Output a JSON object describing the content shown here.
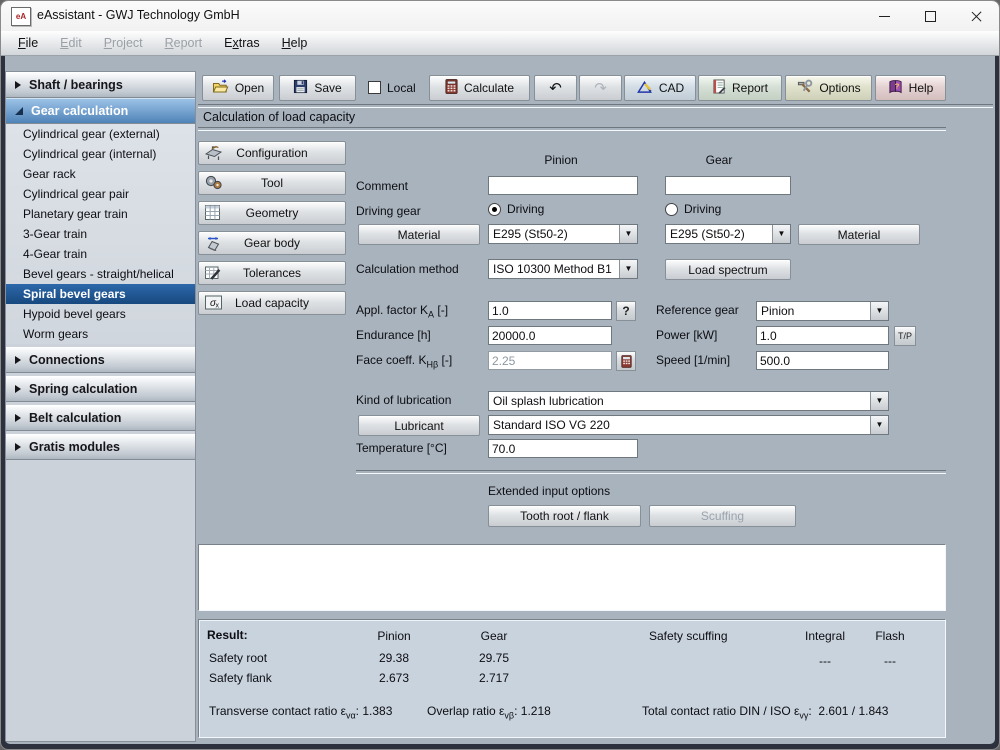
{
  "window": {
    "title": "eAssistant - GWJ Technology GmbH",
    "icon_text": "eA"
  },
  "menu": {
    "items": [
      {
        "pre": "",
        "key": "F",
        "post": "ile",
        "enabled": true
      },
      {
        "pre": "",
        "key": "E",
        "post": "dit",
        "enabled": false
      },
      {
        "pre": "",
        "key": "P",
        "post": "roject",
        "enabled": false
      },
      {
        "pre": "",
        "key": "R",
        "post": "eport",
        "enabled": false
      },
      {
        "pre": "E",
        "key": "x",
        "post": "tras",
        "enabled": true
      },
      {
        "pre": "",
        "key": "H",
        "post": "elp",
        "enabled": true
      }
    ]
  },
  "sidebar": {
    "sections": [
      {
        "label": "Shaft / bearings",
        "state": "collapsed"
      },
      {
        "label": "Gear calculation",
        "state": "expanded",
        "items": [
          "Cylindrical gear (external)",
          "Cylindrical gear (internal)",
          "Gear rack",
          "Cylindrical gear pair",
          "Planetary gear train",
          "3-Gear train",
          "4-Gear train",
          "Bevel gears - straight/helical",
          "Spiral bevel gears",
          "Hypoid bevel gears",
          "Worm gears"
        ],
        "selected_item": "Spiral bevel gears"
      },
      {
        "label": "Connections",
        "state": "collapsed"
      },
      {
        "label": "Spring calculation",
        "state": "collapsed"
      },
      {
        "label": "Belt calculation",
        "state": "collapsed"
      },
      {
        "label": "Gratis modules",
        "state": "collapsed"
      }
    ]
  },
  "toolbar": {
    "open": "Open",
    "save": "Save",
    "local": "Local",
    "calculate": "Calculate",
    "cad": "CAD",
    "report": "Report",
    "options": "Options",
    "help": "Help",
    "undo_icon": "↶",
    "redo_icon": "↷",
    "local_checked": false
  },
  "main": {
    "section_title": "Calculation of load capacity",
    "nav_buttons": [
      "Configuration",
      "Tool",
      "Geometry",
      "Gear body",
      "Tolerances",
      "Load capacity"
    ]
  },
  "form": {
    "col_pinion": "Pinion",
    "col_gear": "Gear",
    "comment_label": "Comment",
    "comment_pinion": "",
    "comment_gear": "",
    "driving_label": "Driving gear",
    "driving_pinion_label": "Driving",
    "driving_gear_label": "Driving",
    "driving_selected": "pinion",
    "material_button_left": "Material",
    "material_button_right": "Material",
    "material_pinion": "E295 (St50-2)",
    "material_gear": "E295 (St50-2)",
    "calc_method_label": "Calculation method",
    "calc_method_value": "ISO 10300 Method B1",
    "load_spectrum_button": "Load spectrum",
    "appl_factor_label": "Appl. factor K",
    "appl_factor_sub": "A",
    "appl_factor_unit": " [-]",
    "appl_factor_value": "1.0",
    "help_button": "?",
    "reference_label": "Reference gear",
    "reference_value": "Pinion",
    "endurance_label": "Endurance [h]",
    "endurance_value": "20000.0",
    "power_label": "Power [kW]",
    "power_value": "1.0",
    "tp_button": "T/P",
    "face_label": "Face coeff. K",
    "face_sub": "Hβ",
    "face_unit": " [-]",
    "face_value": "2.25",
    "speed_label": "Speed [1/min]",
    "speed_value": "500.0",
    "lubrication_label": "Kind of lubrication",
    "lubrication_value": "Oil splash lubrication",
    "lubricant_button": "Lubricant",
    "lubricant_value": "Standard ISO VG 220",
    "temperature_label": "Temperature [°C]",
    "temperature_value": "70.0",
    "extended_label": "Extended input options",
    "tooth_root_button": "Tooth root / flank",
    "scuffing_button": "Scuffing"
  },
  "result": {
    "title": "Result:",
    "col_pinion": "Pinion",
    "col_gear": "Gear",
    "col_scuffing": "Safety scuffing",
    "col_integral": "Integral",
    "col_flash": "Flash",
    "safety_root_label": "Safety root",
    "safety_root_pinion": "29.38",
    "safety_root_gear": "29.75",
    "scuffing_integral": "---",
    "scuffing_flash": "---",
    "safety_flank_label": "Safety flank",
    "safety_flank_pinion": "2.673",
    "safety_flank_gear": "2.717",
    "transverse_label": "Transverse contact ratio ε",
    "transverse_sub": "vα",
    "transverse_value": "1.383",
    "overlap_label": "Overlap ratio ε",
    "overlap_sub": "vβ",
    "overlap_value": "1.218",
    "total_label": "Total contact ratio DIN / ISO ε",
    "total_sub": "vγ",
    "total_value": "2.601  /  1.843",
    "colon": ":"
  },
  "icons": {
    "dropdown": "▼"
  },
  "colors": {
    "content_bg": "#a9b3bd",
    "selected_blue": "#1b5191",
    "section_blue_top": "#9cc2e6",
    "section_blue_bottom": "#4f83b8",
    "result_bg": "#c9d3dd",
    "frame": "#2c313d"
  }
}
